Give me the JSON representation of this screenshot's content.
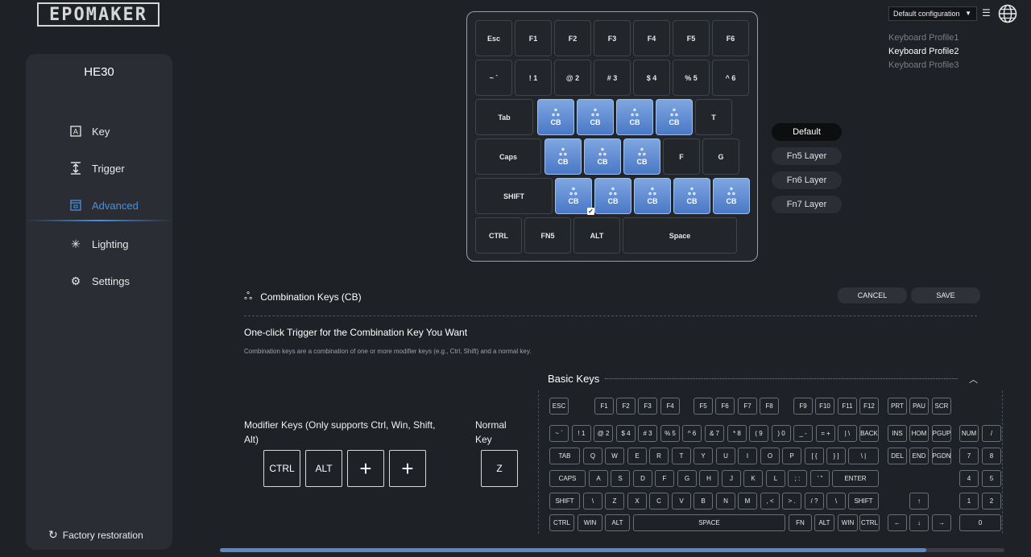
{
  "brand": {
    "logo": "EPOMAKER"
  },
  "sidebar": {
    "device": "HE30",
    "items": [
      {
        "label": "Key",
        "icon": "key-a-icon"
      },
      {
        "label": "Trigger",
        "icon": "trigger-icon"
      },
      {
        "label": "Advanced",
        "icon": "advanced-icon",
        "active": true
      },
      {
        "label": "Lighting",
        "icon": "sun-icon"
      },
      {
        "label": "Settings",
        "icon": "gear-icon"
      }
    ],
    "factory": "Factory restoration"
  },
  "config": {
    "selected": "Default configuration",
    "profiles": [
      "Keyboard Profile1",
      "Keyboard Profile2",
      "Keyboard Profile3"
    ],
    "active_profile": 1
  },
  "keyboard": {
    "row1": [
      "Esc",
      "F1",
      "F2",
      "F3",
      "F4",
      "F5",
      "F6"
    ],
    "row2": [
      "~ `",
      "! 1",
      "@ 2",
      "# 3",
      "$ 4",
      "% 5",
      "^ 6"
    ],
    "row3": [
      "Tab",
      "CB",
      "CB",
      "CB",
      "CB",
      "T"
    ],
    "row4": [
      "Caps",
      "CB",
      "CB",
      "CB",
      "F",
      "G"
    ],
    "row5": [
      "SHIFT",
      "CB",
      "CB",
      "CB",
      "CB",
      "CB"
    ],
    "row6": [
      "CTRL",
      "FN5",
      "ALT",
      "Space"
    ]
  },
  "layers": [
    "Default",
    "Fn5 Layer",
    "Fn6 Layer",
    "Fn7 Layer"
  ],
  "cb": {
    "title": "Combination Keys (CB)",
    "cancel": "CANCEL",
    "save": "SAVE",
    "heading": "One-click Trigger for the Combination Key You Want",
    "desc": "Combination keys are a combination of one or more modifier keys (e.g., Ctrl, Shift) and a normal key.",
    "modifier_label": "Modifier Keys (Only supports Ctrl, Win, Shift, Alt)",
    "normal_label": "Normal Key",
    "modifiers": [
      "CTRL",
      "ALT",
      "+",
      "+"
    ],
    "normal": "Z"
  },
  "basic_keys": {
    "title": "Basic Keys",
    "rows": [
      [
        "ESC",
        "F1",
        "F2",
        "F3",
        "F4",
        "F5",
        "F6",
        "F7",
        "F8",
        "F9",
        "F10",
        "F11",
        "F12",
        "PRT",
        "PAU",
        "SCR"
      ],
      [
        "~ `",
        "! 1",
        "@ 2",
        "# 3",
        "$ 4",
        "% 5",
        "^ 6",
        "& 7",
        "* 8",
        "( 9",
        ") 0",
        "_ -",
        "= +",
        "| \\",
        "BACK",
        "INS",
        "HOM",
        "PGUP",
        "NUM",
        "/"
      ],
      [
        "TAB",
        "Q",
        "W",
        "E",
        "R",
        "T",
        "Y",
        "U",
        "I",
        "O",
        "P",
        "[ {",
        "} ]",
        "\\ |",
        "DEL",
        "END",
        "PGDN",
        "7",
        "8"
      ],
      [
        "CAPS",
        "A",
        "S",
        "D",
        "F",
        "G",
        "H",
        "J",
        "K",
        "L",
        "; :",
        "' \"",
        "ENTER",
        "4",
        "5"
      ],
      [
        "SHIFT",
        "\\",
        "Z",
        "X",
        "C",
        "V",
        "B",
        "N",
        "M",
        ", <",
        "> .",
        "/ ?",
        "\\",
        "SHIFT",
        "↑",
        "1",
        "2"
      ],
      [
        "CTRL",
        "WIN",
        "ALT",
        "SPACE",
        "FN",
        "ALT",
        "WIN",
        "CTRL",
        "←",
        "↓",
        "→",
        "0"
      ]
    ]
  }
}
